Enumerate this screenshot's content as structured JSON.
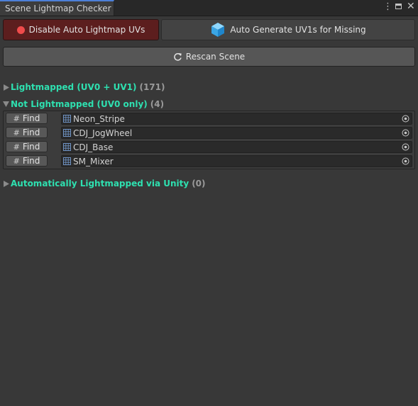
{
  "window": {
    "tab_title": "Scene Lightmap Checker",
    "controls": [
      "kebab-menu-icon",
      "maximize-icon",
      "close-icon"
    ]
  },
  "toolbar": {
    "disable_label": "Disable Auto Lightmap UVs",
    "disable_icon": "red-dot-icon",
    "auto_generate_label": "Auto Generate UV1s for Missing",
    "auto_generate_icon": "cube-icon",
    "rescan_label": "Rescan Scene",
    "rescan_icon": "refresh-icon"
  },
  "sections": [
    {
      "label": "Lightmapped (UV0 + UV1)",
      "count": "(171)",
      "expanded": false
    },
    {
      "label": "Not Lightmapped (UV0 only)",
      "count": "(4)",
      "expanded": true
    },
    {
      "label": "Automatically Lightmapped via Unity",
      "count": "(0)",
      "expanded": false
    }
  ],
  "not_lightmapped_items": [
    {
      "find_label": "Find",
      "object": "Neon_Stripe"
    },
    {
      "find_label": "Find",
      "object": "CDJ_JogWheel"
    },
    {
      "find_label": "Find",
      "object": "CDJ_Base"
    },
    {
      "find_label": "Find",
      "object": "SM_Mixer"
    }
  ],
  "colors": {
    "accent_green": "#2ee0b0",
    "disable_button_bg": "#5c1e1e",
    "record_dot": "#ef4b4b",
    "tab_highlight": "#4c7fd8"
  }
}
